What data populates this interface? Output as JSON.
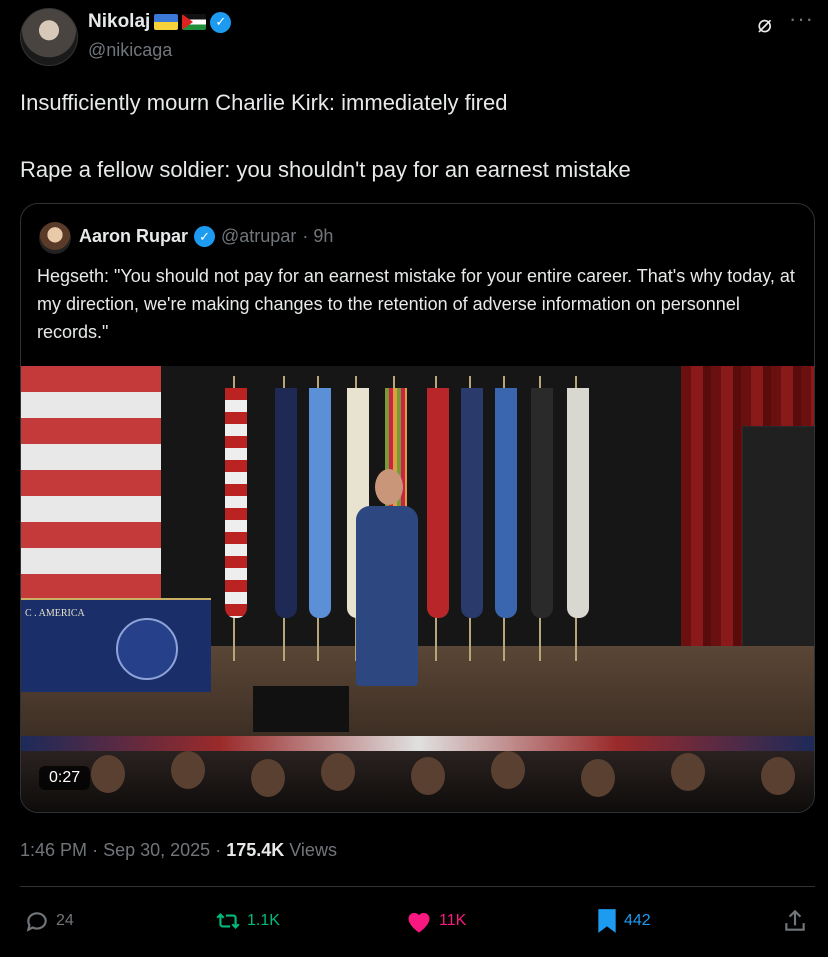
{
  "author": {
    "display_name": "Nikolaj",
    "handle": "@nikicaga",
    "verified": true
  },
  "tweet": {
    "line1": "Insufficiently mourn Charlie Kirk: immediately fired",
    "line2": "Rape a fellow soldier: you shouldn't pay for an earnest mistake"
  },
  "quote": {
    "display_name": "Aaron Rupar",
    "handle": "@atrupar",
    "time": "· 9h",
    "text": "Hegseth: \"You should not pay for an earnest mistake for your entire career. That's why today, at my direction, we're making changes to the retention of adverse information on personnel records.\"",
    "video_duration": "0:27",
    "podium_text": "C . AMERICA"
  },
  "meta": {
    "time": "1:46 PM",
    "date": "Sep 30, 2025",
    "views_count": "175.4K",
    "views_label": "Views"
  },
  "actions": {
    "replies": "24",
    "reposts": "1.1K",
    "likes": "11K",
    "bookmarks": "442"
  },
  "colors": {
    "accent": "#1d9bf0",
    "repost": "#00ba7c",
    "like": "#f91880",
    "muted": "#71767b"
  },
  "icons": [
    "grok-icon",
    "more-icon",
    "reply-icon",
    "repost-icon",
    "like-icon",
    "bookmark-icon",
    "share-icon",
    "verified-icon"
  ]
}
